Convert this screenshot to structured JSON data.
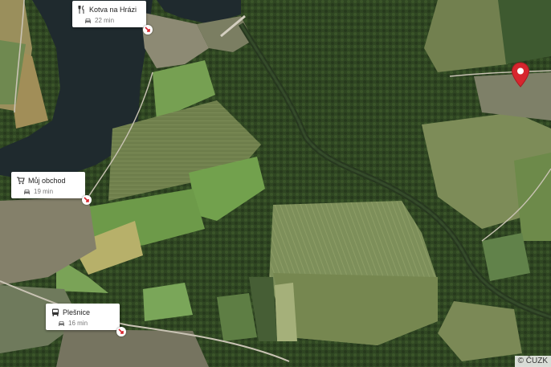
{
  "map": {
    "copyright": "© ČUZK",
    "selected_marker_icon": "location-pin-icon",
    "marker_color": "#d7262e"
  },
  "pois": [
    {
      "id": "kotva",
      "icon": "restaurant-icon",
      "name": "Kotva na Hrázi",
      "travel_icon": "car-icon",
      "travel_time": "22 min"
    },
    {
      "id": "obchod",
      "icon": "shopping-cart-icon",
      "name": "Můj obchod",
      "travel_icon": "car-icon",
      "travel_time": "19 min"
    },
    {
      "id": "plesnice",
      "icon": "bus-icon",
      "name": "Plešnice",
      "travel_icon": "car-icon",
      "travel_time": "16 min"
    }
  ]
}
